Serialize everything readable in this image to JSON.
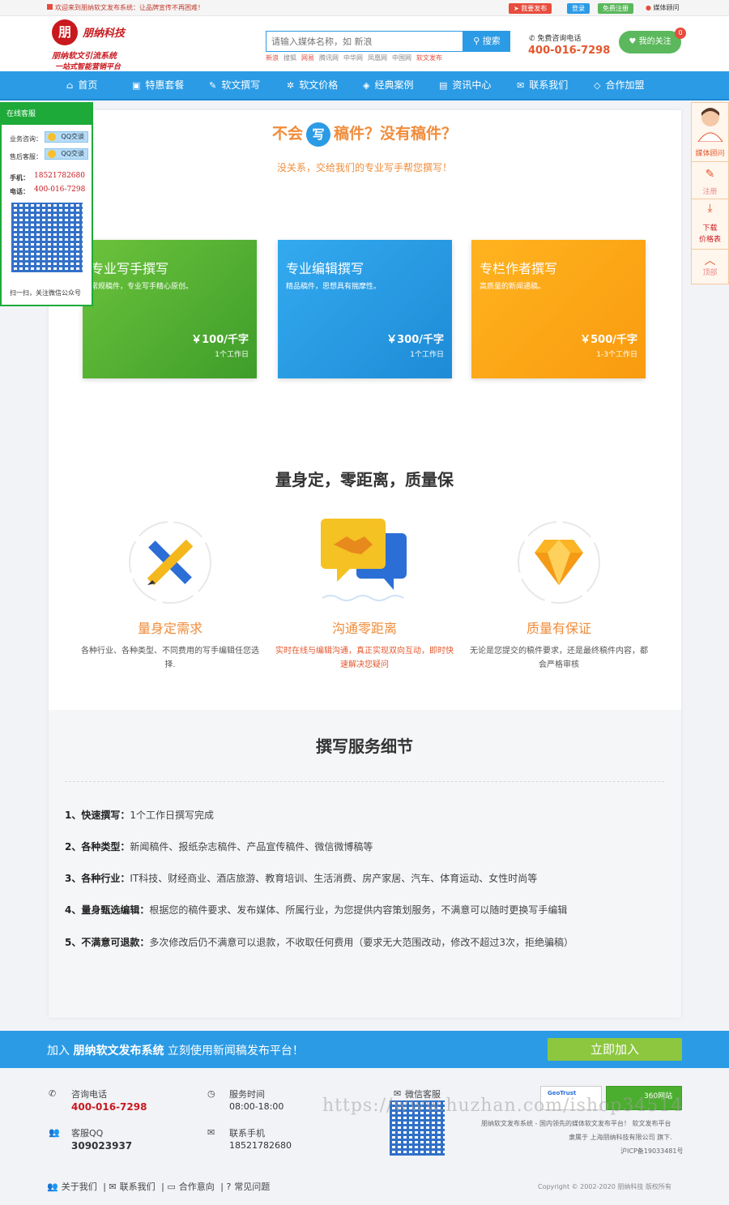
{
  "topbar": {
    "welcome": "欢迎来到朋纳软文发布系统：让品牌宣传不再困难！",
    "publish": "我要发布",
    "login": "登录",
    "register": "免费注册",
    "advisor": "媒体顾问"
  },
  "logo": {
    "char": "朋",
    "name": "朋纳科技",
    "sub1": "朋纳软文引流系统",
    "sub2": "一站式智能营销平台"
  },
  "search": {
    "placeholder": "请输入媒体名称，如 新浪",
    "button": "搜索",
    "hot": [
      "新浪",
      "搜狐",
      "网易",
      "腾讯网",
      "中华网",
      "凤凰网",
      "中国网",
      "软文发布"
    ]
  },
  "contact": {
    "label": "免费咨询电话",
    "phone": "400-016-7298",
    "follow": "我的关注",
    "follow_count": "0"
  },
  "nav": [
    {
      "icon": "home-icon",
      "label": "首页"
    },
    {
      "icon": "package-icon",
      "label": "特惠套餐"
    },
    {
      "icon": "pen-icon",
      "label": "软文撰写"
    },
    {
      "icon": "tag-icon",
      "label": "软文价格"
    },
    {
      "icon": "tags-icon",
      "label": "经典案例"
    },
    {
      "icon": "news-icon",
      "label": "资讯中心"
    },
    {
      "icon": "mail-icon",
      "label": "联系我们"
    },
    {
      "icon": "diamond-icon",
      "label": "合作加盟"
    }
  ],
  "hero": {
    "pre": "不会",
    "circle": "写",
    "post": "稿件？没有稿件？",
    "subtitle": "没关系，交给我们的专业写手帮您撰写！"
  },
  "pricing": [
    {
      "title": "专业写手撰写",
      "desc": "常规稿件，专业写手精心原创。",
      "price": "￥100/千字",
      "time": "1个工作日",
      "color": "#4cae2e"
    },
    {
      "title": "专业编辑撰写",
      "desc": "精品稿件，思想具有揣摩性。",
      "price": "￥300/千字",
      "time": "1个工作日",
      "color": "#2a9ee4"
    },
    {
      "title": "专栏作者撰写",
      "desc": "高质量的新闻通稿。",
      "price": "￥500/千字",
      "time": "1-3个工作日",
      "color": "#fbaa1a"
    }
  ],
  "features": {
    "title": "量身定，零距离，质量保",
    "items": [
      {
        "icon": "ruler-pencil-icon",
        "title": "量身定需求",
        "desc": "各种行业、各种类型、不同费用的写手编辑任您选择."
      },
      {
        "icon": "handshake-chat-icon",
        "title": "沟通零距离",
        "desc": "实时在线与编辑沟通，真正实现双向互动，即时快速解决您疑问"
      },
      {
        "icon": "diamond-icon",
        "title": "质量有保证",
        "desc": "无论是您提交的稿件要求，还是最终稿件内容，都会严格审核"
      }
    ]
  },
  "details": {
    "title": "撰写服务细节",
    "rows": [
      {
        "label": "1、快速撰写：",
        "text": "1个工作日撰写完成"
      },
      {
        "label": "2、各种类型：",
        "text": "新闻稿件、报纸杂志稿件、产品宣传稿件、微信微博稿等"
      },
      {
        "label": "3、各种行业：",
        "text": "IT科技、财经商业、酒店旅游、教育培训、生活消费、房产家居、汽车、体育运动、女性时尚等"
      },
      {
        "label": "4、量身甄选编辑：",
        "text": "根据您的稿件要求、发布媒体、所属行业，为您提供内容策划服务，不满意可以随时更换写手编辑"
      },
      {
        "label": "5、不满意可退款：",
        "text": "多次修改后仍不满意可以退款，不收取任何费用（要求无大范围改动，修改不超过3次，拒绝骗稿）"
      }
    ]
  },
  "join": {
    "pre": "加入",
    "brand": "朋纳软文发布系统",
    "post": "立刻使用新闻稿发布平台！",
    "button": "立即加入"
  },
  "footer": {
    "tel_label": "咨询电话",
    "tel": "400-016-7298",
    "hours_label": "服务时间",
    "hours": "08:00-18:00",
    "wechat_label": "微信客服",
    "qq_label": "客服QQ",
    "qq": "309023937",
    "mobile_label": "联系手机",
    "mobile": "18521782680",
    "badge1": "GeoTrust",
    "badge2": "360网站",
    "info1": "朋纳软文发布系统 - 国内领先的媒体软文发布平台！ 软文发布平台",
    "info2": "隶属于 上海朋纳科技有限公司 旗下.",
    "icp": "沪ICP备19033481号",
    "links": [
      "关于我们",
      "联系我们",
      "合作意向",
      "常见问题"
    ],
    "copyright": "Copyright © 2002-2020 朋纳科技 版权所有"
  },
  "service": {
    "title": "在线客服",
    "biz_label": "业务咨询：",
    "after_label": "售后客服：",
    "qq_btn": "QQ交谈",
    "mobile_label": "手机：",
    "mobile": "18521782680",
    "tel_label": "电话：",
    "tel": "400-016-7298",
    "scan": "扫一扫，关注微信公众号"
  },
  "rightbar": {
    "advisor": "媒体顾问",
    "register": "注册",
    "download": "下载",
    "pricelist": "价格表",
    "top": "顶部"
  },
  "watermark": "https://www.huzhan.com/ishop34514"
}
